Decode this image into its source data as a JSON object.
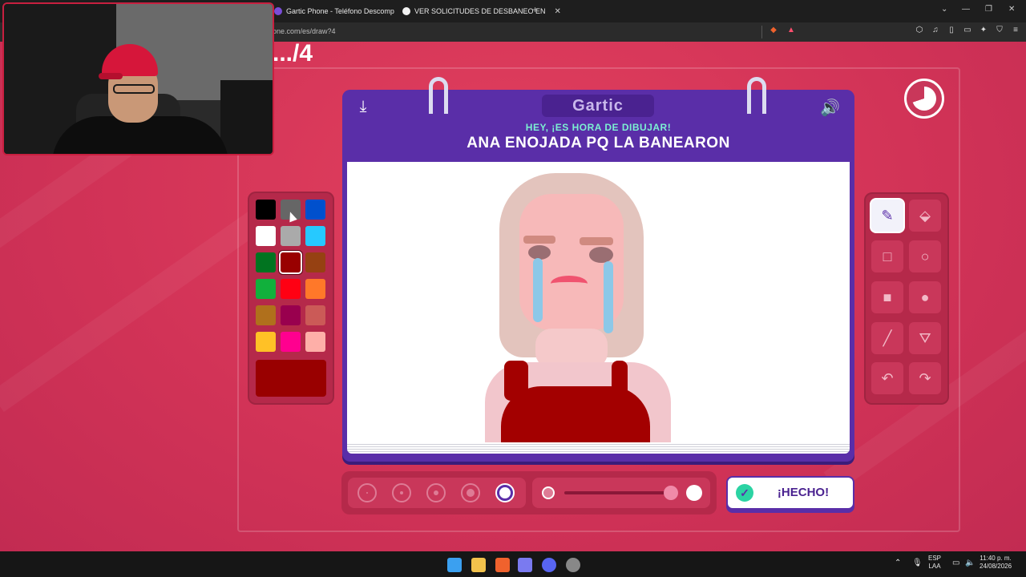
{
  "browser": {
    "tabs": [
      {
        "title": "Gartic Phone - Teléfono Descomp"
      },
      {
        "title": "VER SOLICITUDES DE DESBANEO EN"
      }
    ],
    "url": "one.com/es/draw?4"
  },
  "game": {
    "round": ".../4",
    "logo": "Gartic",
    "subtitle": "HEY, ¡ES HORA DE DIBUJAR!",
    "prompt": "ANA ENOJADA PQ LA BANEARON",
    "done_label": "¡HECHO!",
    "selected_color": "#990000",
    "palette": [
      "#000000",
      "#666666",
      "#0050cd",
      "#ffffff",
      "#aaaaaa",
      "#26c9ff",
      "#017420",
      "#990000",
      "#964112",
      "#11b03c",
      "#ff0013",
      "#ff7829",
      "#b0701c",
      "#99004e",
      "#cb5a57",
      "#ffc126",
      "#ff008f",
      "#feafa8"
    ],
    "tools": [
      "pencil-tool",
      "eraser-tool",
      "square-outline-tool",
      "circle-outline-tool",
      "square-fill-tool",
      "circle-fill-tool",
      "line-tool",
      "fill-bucket-tool",
      "undo-tool",
      "redo-tool"
    ],
    "brush_sizes_active_index": 4,
    "opacity_level": 0.95
  },
  "taskbar": {
    "lang": "ESP",
    "lang2": "LAA",
    "time": "11:40 p. m.",
    "date": "24/08/2026"
  }
}
